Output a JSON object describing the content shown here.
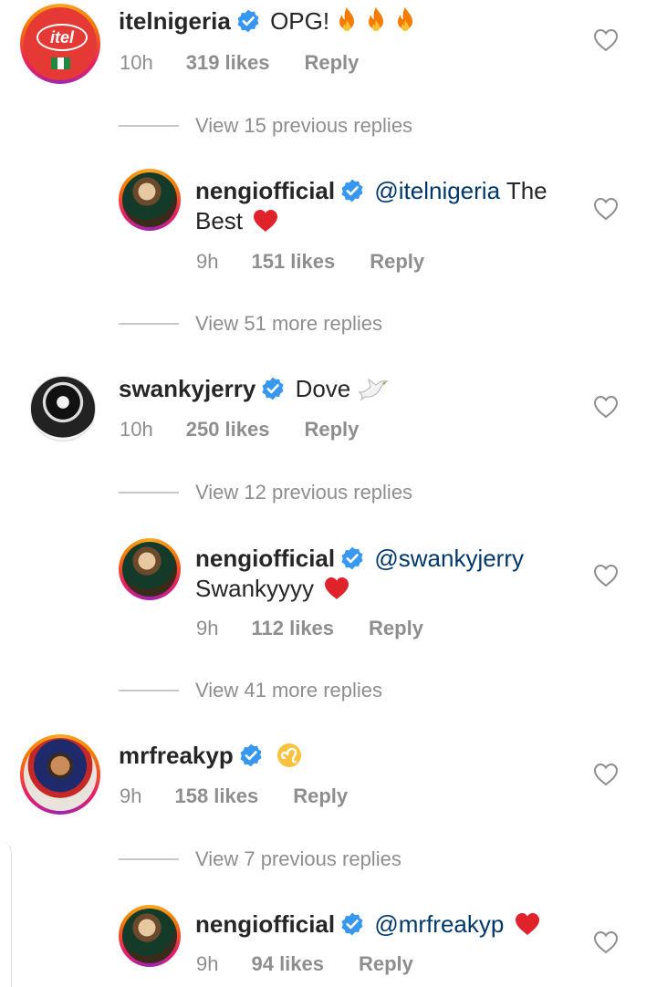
{
  "comments": [
    {
      "username": "itelnigeria",
      "text": "OPG!",
      "emoji": "fire-x3",
      "time": "10h",
      "likes": "319 likes",
      "reply": "Reply"
    },
    {
      "username": "nengiofficial",
      "mention": "@itelnigeria",
      "text_after_mention": "The",
      "text_line2": "Best",
      "time": "9h",
      "likes": "151 likes",
      "reply": "Reply"
    },
    {
      "username": "swankyjerry",
      "text": "Dove",
      "emoji": "dove",
      "time": "10h",
      "likes": "250 likes",
      "reply": "Reply"
    },
    {
      "username": "nengiofficial",
      "mention": "@swankyjerry",
      "text_line2": "Swankyyyy",
      "time": "9h",
      "likes": "112 likes",
      "reply": "Reply"
    },
    {
      "username": "mrfreakyp",
      "emoji": "leo",
      "time": "9h",
      "likes": "158 likes",
      "reply": "Reply"
    },
    {
      "username": "nengiofficial",
      "mention": "@mrfreakyp",
      "time": "9h",
      "likes": "94 likes",
      "reply": "Reply"
    }
  ],
  "view_rows": [
    "View 15 previous replies",
    "View 51 more replies",
    "View 12 previous replies",
    "View 41 more replies",
    "View 7 previous replies"
  ],
  "colors": {
    "verified": "#3897f0",
    "mention": "#00376b",
    "meta": "#8e8e8e",
    "heart": "#e0222b"
  }
}
